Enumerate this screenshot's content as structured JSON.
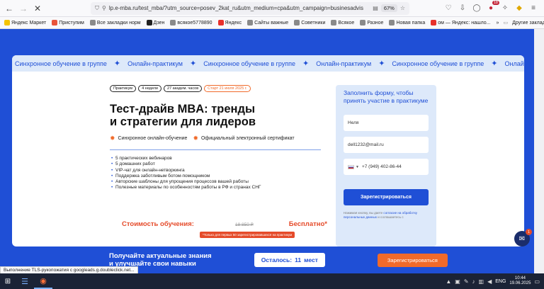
{
  "browser": {
    "url": "lp.e-mba.ru/test_mba/?utm_source=posev_2kat_ru&utm_medium=cpa&utm_campaign=businesadvis",
    "zoom": "67%",
    "extension_badge": "18"
  },
  "bookmarks": [
    {
      "label": "Яндекс Маркет",
      "color": "#f5c400"
    },
    {
      "label": "Приступим",
      "color": "#e8543a"
    },
    {
      "label": "Все закладки норм",
      "color": "#8a8a8a"
    },
    {
      "label": "Дзен",
      "color": "#222222"
    },
    {
      "label": "всякое5778890",
      "color": "#8a8a8a"
    },
    {
      "label": "Яндекс",
      "color": "#e8312c"
    },
    {
      "label": "Сайты важные",
      "color": "#8a8a8a"
    },
    {
      "label": "Советники",
      "color": "#8a8a8a"
    },
    {
      "label": "Всякое",
      "color": "#8a8a8a"
    },
    {
      "label": "Разное",
      "color": "#8a8a8a"
    },
    {
      "label": "Новая папка",
      "color": "#8a8a8a"
    },
    {
      "label": "ом — Яндекс: нашло...",
      "color": "#e8312c"
    }
  ],
  "bookmarks_other": "Другие закладки",
  "ticker": [
    "Синхронное обучение в группе",
    "Онлайн-практикум",
    "Синхронное обучение в группе",
    "Онлайн-практикум",
    "Синхронное обучение в группе",
    "Онлайн-практикум",
    "Синх"
  ],
  "course": {
    "chips": [
      "Практикум",
      "4 недели",
      "27 академ. часов",
      "Старт 21 июля 2025 г."
    ],
    "title_line1": "Тест-драйв MBA: тренды",
    "title_line2": "и стратегии для лидеров",
    "feature1": "Синхронное онлайн-обучение",
    "feature2": "Официальный электронный сертификат",
    "bullets": [
      "5 практических вебинаров",
      "5 домашних работ",
      "VIP-чат для онлайн-нетворкинга",
      "Поддержка заботливым ботом-помощником",
      "Авторские шаблоны для упрощения процессов вашей работы",
      "Полезные материалы по особенностям работы в РФ и странах СНГ"
    ],
    "price_label": "Стоимость обучения:",
    "price_old": "18 850 ₽",
    "price_free": "Бесплатно*",
    "promo_note": "*Только для первых 50 зарегистрировавшихся на практикум"
  },
  "form": {
    "title": "Заполнить форму, чтобы принять участие в практикуме",
    "name_value": "Неля",
    "email_value": "dell1232@mail.ru",
    "phone_value": "+7 (949) 402-86-44",
    "submit_label": "Зарегистрироваться",
    "consent_text": "Нажимая кнопку, вы даете ",
    "consent_link": "согласие на обработку персональных данных",
    "consent_tail": " и соглашаетесь с"
  },
  "bottom_bar": {
    "text_line1": "Получайте актуальные знания",
    "text_line2": "и улучшайте свои навыки",
    "remaining_label": "Осталось:",
    "remaining_count": "11",
    "remaining_unit": "мест",
    "button_label": "Зарегистрироваться"
  },
  "chat_badge": "1",
  "status_tooltip": "Выполнение TLS-рукопожатия с googleads.g.doubleclick.net...",
  "taskbar": {
    "language": "ENG",
    "time": "10:44",
    "date": "19.06.2025"
  }
}
